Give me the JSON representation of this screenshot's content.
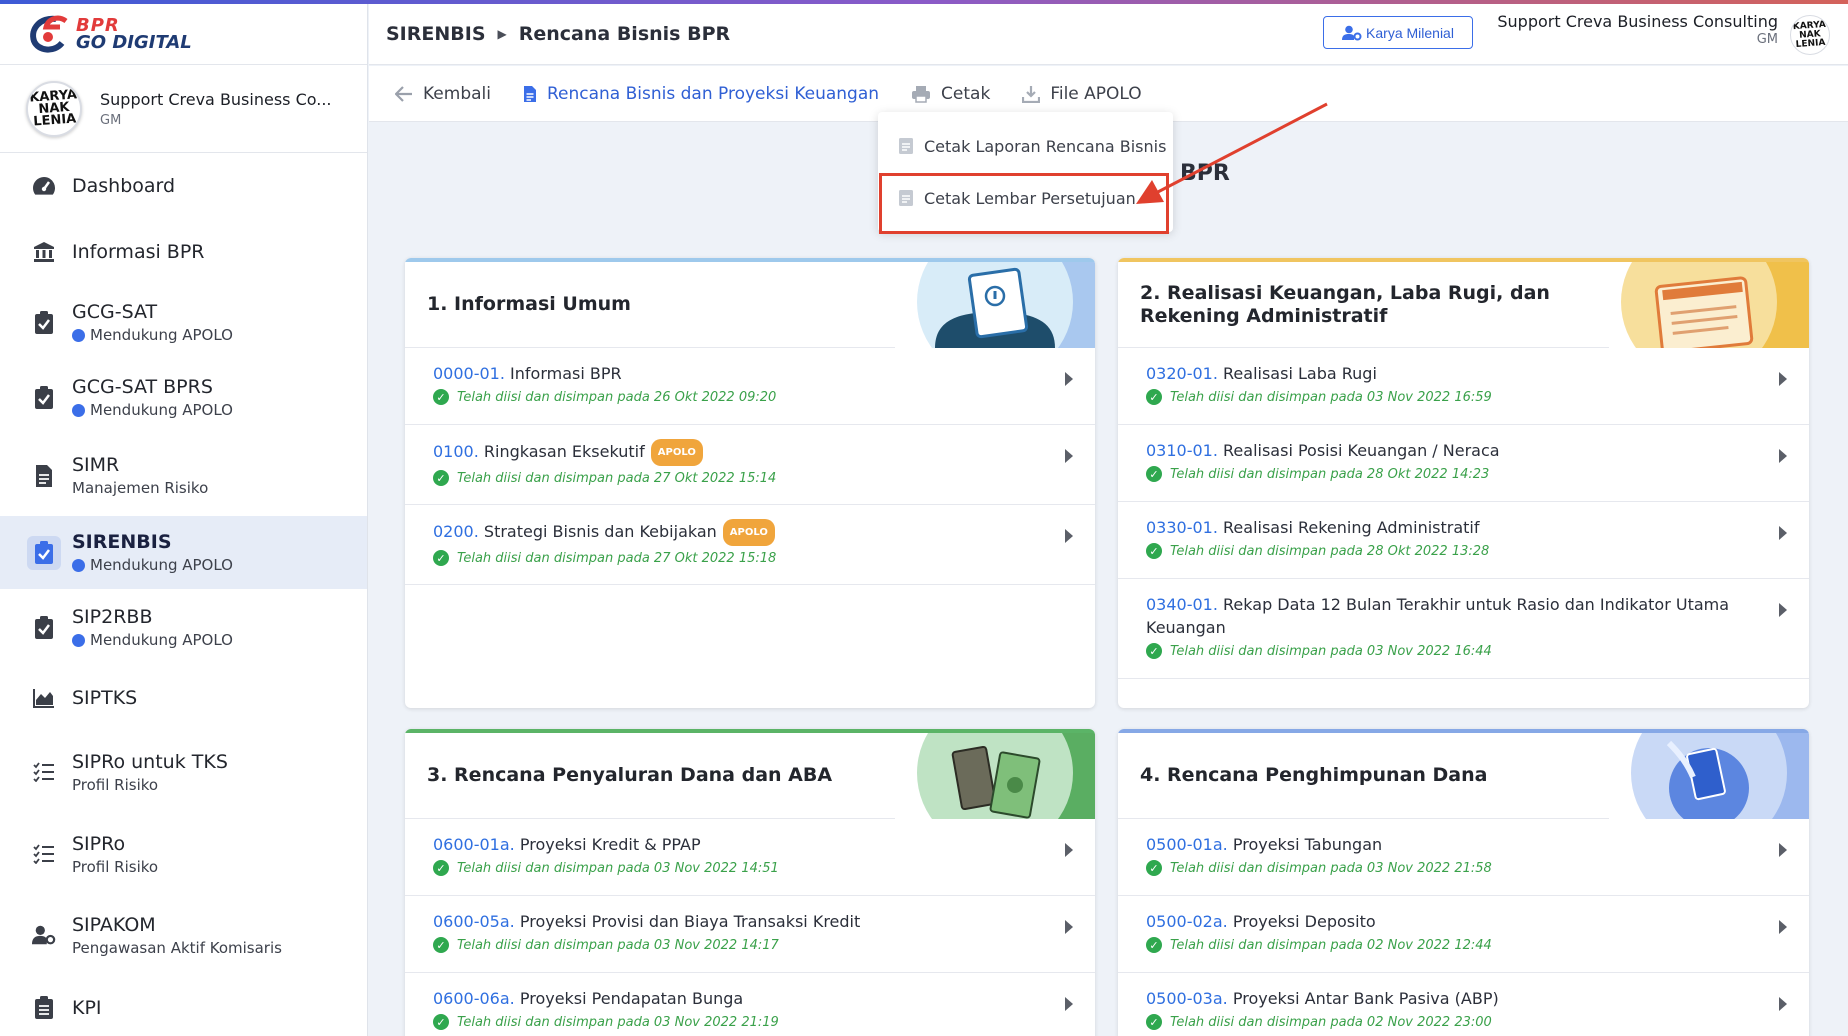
{
  "brand": {
    "line1": "BPR",
    "line2": "GO DIGITAL"
  },
  "profile": {
    "name": "Support Creva Business Co...",
    "role": "GM",
    "avatar_text": "KARYA NAK LENIA"
  },
  "nav": [
    {
      "label": "Dashboard",
      "sub": "",
      "icon": "dashboard-icon"
    },
    {
      "label": "Informasi BPR",
      "sub": "",
      "icon": "bank-icon"
    },
    {
      "label": "GCG-SAT",
      "sub": "Mendukung APOLO",
      "icon": "clipboard-check-icon"
    },
    {
      "label": "GCG-SAT BPRS",
      "sub": "Mendukung APOLO",
      "icon": "clipboard-check-icon"
    },
    {
      "label": "SIMR",
      "sub": "Manajemen Risiko",
      "icon": "file-icon"
    },
    {
      "label": "SIRENBIS",
      "sub": "Mendukung APOLO",
      "icon": "clipboard-check-icon"
    },
    {
      "label": "SIP2RBB",
      "sub": "Mendukung APOLO",
      "icon": "clipboard-check-icon"
    },
    {
      "label": "SIPTKS",
      "sub": "",
      "icon": "area-chart-icon"
    },
    {
      "label": "SIPRo untuk TKS",
      "sub": "Profil Risiko",
      "icon": "checklist-icon"
    },
    {
      "label": "SIPRo",
      "sub": "Profil Risiko",
      "icon": "checklist-icon"
    },
    {
      "label": "SIPAKOM",
      "sub": "Pengawasan Aktif Komisaris",
      "icon": "user-cog-icon"
    },
    {
      "label": "KPI",
      "sub": "",
      "icon": "clipboard-list-icon"
    }
  ],
  "header": {
    "breadcrumb": [
      "SIRENBIS",
      "Rencana Bisnis BPR"
    ],
    "karya_button": "Karya Milenial",
    "user_name": "Support Creva Business Consulting",
    "user_role": "GM"
  },
  "toolbar": {
    "back": "Kembali",
    "rencana": "Rencana Bisnis dan Proyeksi Keuangan",
    "cetak": "Cetak",
    "file_apolo": "File APOLO"
  },
  "dropdown": {
    "item1": "Cetak Laporan Rencana Bisnis",
    "item2": "Cetak Lembar Persetujuan"
  },
  "page_title_fragment": "BPR",
  "cards": [
    {
      "title": "1. Informasi Umum",
      "rows": [
        {
          "code": "0000-01.",
          "title": "Informasi BPR",
          "badge": "",
          "status": "Telah diisi dan disimpan pada 26 Okt 2022 09:20"
        },
        {
          "code": "0100.",
          "title": "Ringkasan Eksekutif",
          "badge": "APOLO",
          "status": "Telah diisi dan disimpan pada 27 Okt 2022 15:14"
        },
        {
          "code": "0200.",
          "title": "Strategi Bisnis dan Kebijakan",
          "badge": "APOLO",
          "status": "Telah diisi dan disimpan pada 27 Okt 2022 15:18"
        }
      ]
    },
    {
      "title": "2. Realisasi Keuangan, Laba Rugi, dan Rekening Administratif",
      "rows": [
        {
          "code": "0320-01.",
          "title": "Realisasi Laba Rugi",
          "badge": "",
          "status": "Telah diisi dan disimpan pada 03 Nov 2022 16:59"
        },
        {
          "code": "0310-01.",
          "title": "Realisasi Posisi Keuangan / Neraca",
          "badge": "",
          "status": "Telah diisi dan disimpan pada 28 Okt 2022 14:23"
        },
        {
          "code": "0330-01.",
          "title": "Realisasi Rekening Administratif",
          "badge": "",
          "status": "Telah diisi dan disimpan pada 28 Okt 2022 13:28"
        },
        {
          "code": "0340-01.",
          "title": "Rekap Data 12 Bulan Terakhir untuk Rasio dan Indikator Utama Keuangan",
          "badge": "",
          "status": "Telah diisi dan disimpan pada 03 Nov 2022 16:44"
        }
      ]
    },
    {
      "title": "3. Rencana Penyaluran Dana dan ABA",
      "rows": [
        {
          "code": "0600-01a.",
          "title": "Proyeksi Kredit & PPAP",
          "badge": "",
          "status": "Telah diisi dan disimpan pada 03 Nov 2022 14:51"
        },
        {
          "code": "0600-05a.",
          "title": "Proyeksi Provisi dan Biaya Transaksi Kredit",
          "badge": "",
          "status": "Telah diisi dan disimpan pada 03 Nov 2022 14:17"
        },
        {
          "code": "0600-06a.",
          "title": "Proyeksi Pendapatan Bunga",
          "badge": "",
          "status": "Telah diisi dan disimpan pada 03 Nov 2022 21:19"
        }
      ]
    },
    {
      "title": "4. Rencana Penghimpunan Dana",
      "rows": [
        {
          "code": "0500-01a.",
          "title": "Proyeksi Tabungan",
          "badge": "",
          "status": "Telah diisi dan disimpan pada 03 Nov 2022 21:58"
        },
        {
          "code": "0500-02a.",
          "title": "Proyeksi Deposito",
          "badge": "",
          "status": "Telah diisi dan disimpan pada 02 Nov 2022 12:44"
        },
        {
          "code": "0500-03a.",
          "title": "Proyeksi Antar Bank Pasiva (ABP)",
          "badge": "",
          "status": "Telah diisi dan disimpan pada 02 Nov 2022 23:00"
        }
      ]
    }
  ],
  "colors": {
    "accent": "#2f6fe0",
    "success": "#2fa84f",
    "badge": "#f0a53c",
    "highlight": "#e0402e"
  }
}
